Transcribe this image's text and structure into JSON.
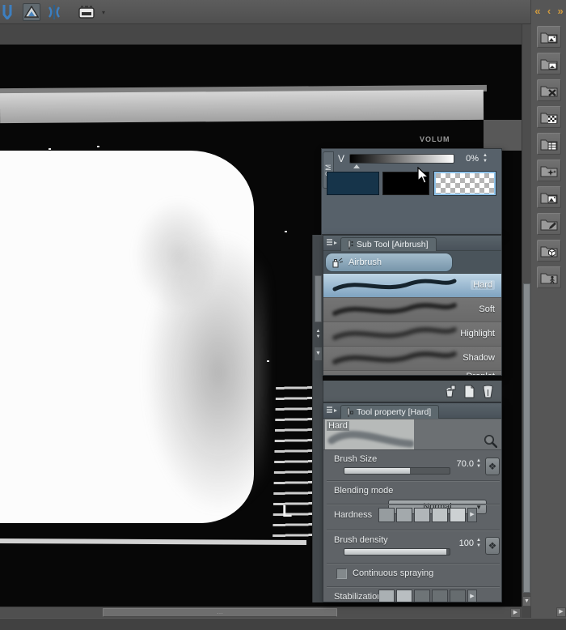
{
  "toolbar": {
    "icons": [
      "pen-tool-icon",
      "ruler-tool-icon",
      "symmetry-tool-icon",
      "screen-mode-icon"
    ],
    "dropdown_glyph": "▾"
  },
  "sidebar": {
    "chevrons": {
      "collapse_all": "«",
      "back": "‹",
      "forward": "»"
    },
    "folders": [
      "folder-image",
      "folder-photo",
      "folder-delete",
      "folder-pattern",
      "folder-grid",
      "folder-effects",
      "folder-picture",
      "folder-edit",
      "folder-3d",
      "folder-figure"
    ],
    "arrow_right": "▶"
  },
  "canvas": {
    "tv_label": "VOLUM",
    "letter": "L"
  },
  "color_panel": {
    "side_tab": "CM",
    "channel": "V",
    "value": "0%",
    "spin_up": "▲",
    "spin_down": "▼",
    "swatches": [
      {
        "name": "main-color",
        "color": "#16344a"
      },
      {
        "name": "sub-color",
        "color": "#000000"
      },
      {
        "name": "transparent-color",
        "selected": true
      }
    ]
  },
  "scroll_strip": {
    "up": "▲",
    "down": "▼"
  },
  "subtool_panel": {
    "title": "Sub Tool [Airbrush]",
    "tool_label": "Airbrush",
    "brushes": [
      {
        "label": "Hard",
        "selected": true
      },
      {
        "label": "Soft"
      },
      {
        "label": "Highlight"
      },
      {
        "label": "Shadow"
      },
      {
        "label": "Droplet",
        "clipped": true
      }
    ],
    "actions": [
      "duplicate-subtool-icon",
      "new-subtool-icon",
      "delete-subtool-icon"
    ]
  },
  "toolprop_panel": {
    "title": "Tool property [Hard]",
    "preview_label": "Hard",
    "brush_size": {
      "label": "Brush Size",
      "value": "70.0",
      "fill_pct": 62
    },
    "blending": {
      "label": "Blending mode",
      "value": "Normal",
      "arrow": "▼"
    },
    "hardness": {
      "label": "Hardness",
      "levels": 5,
      "more": "▶"
    },
    "density": {
      "label": "Brush density",
      "value": "100",
      "fill_pct": 97
    },
    "continuous": {
      "label": "Continuous spraying",
      "checked": false
    },
    "stabilization": {
      "label": "Stabilization",
      "more": "▶"
    },
    "dynamics_glyph": "❖",
    "spin_up": "▲",
    "spin_down": "▼"
  },
  "scrollbars": {
    "down": "▼",
    "right": "▶",
    "grip": "⋯"
  },
  "colors": {
    "selection_blue": "#8fc3ea",
    "panel_gray": "#58616a",
    "accent_tab": "#5d686e",
    "brush_selected_top": "#bdd4e4",
    "brush_selected_bottom": "#7fa3c0"
  }
}
